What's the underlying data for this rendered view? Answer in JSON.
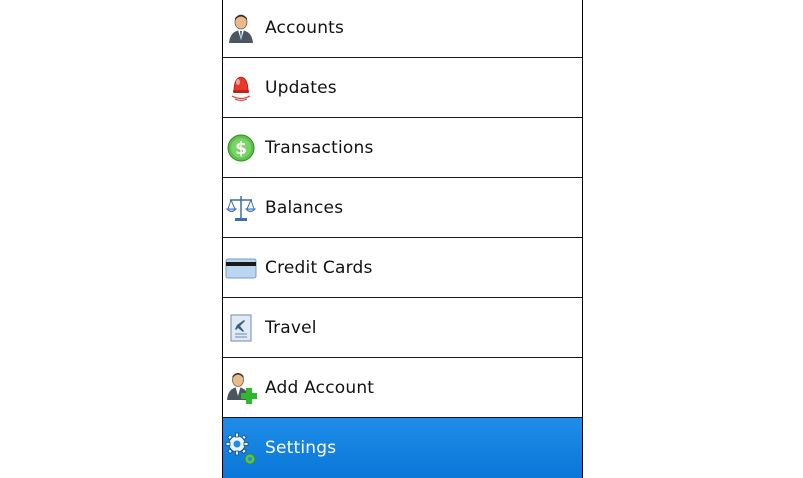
{
  "menu": {
    "items": [
      {
        "label": "Accounts",
        "icon": "person-icon",
        "selected": false
      },
      {
        "label": "Updates",
        "icon": "alert-bell-icon",
        "selected": false
      },
      {
        "label": "Transactions",
        "icon": "dollar-coin-icon",
        "selected": false
      },
      {
        "label": "Balances",
        "icon": "scales-icon",
        "selected": false
      },
      {
        "label": "Credit Cards",
        "icon": "credit-card-icon",
        "selected": false
      },
      {
        "label": "Travel",
        "icon": "travel-document-icon",
        "selected": false
      },
      {
        "label": "Add Account",
        "icon": "add-person-icon",
        "selected": false
      },
      {
        "label": "Settings",
        "icon": "gear-icon",
        "selected": true
      }
    ]
  },
  "colors": {
    "selection": "#0a77d8",
    "divider": "#1a1a1a",
    "text": "#111111"
  }
}
